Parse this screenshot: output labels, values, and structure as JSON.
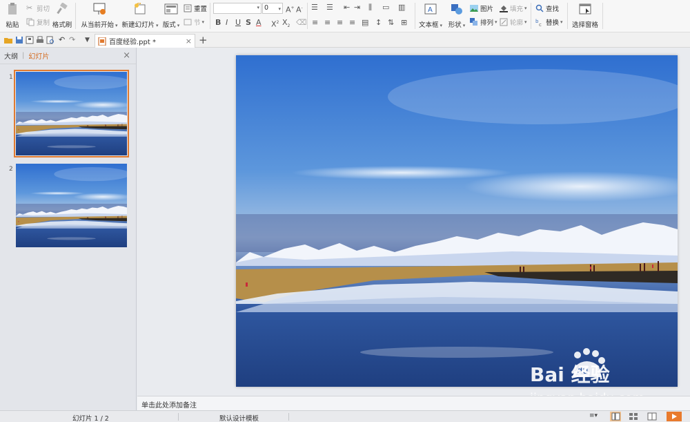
{
  "ribbon": {
    "clipboard": {
      "paste": "粘贴",
      "cut": "剪切",
      "copy": "复制",
      "format_painter": "格式刷"
    },
    "slides": {
      "from_current": "从当前开始",
      "new_slide": "新建幻灯片",
      "layout": "版式",
      "reset": "重置",
      "section": "节"
    },
    "font": {
      "font_name": "",
      "font_size": "0"
    },
    "drawing": {
      "textbox": "文本框",
      "shape": "形状",
      "picture": "图片",
      "arrange": "排列",
      "fill": "填充",
      "outline": "轮廓"
    },
    "editing": {
      "find": "查找",
      "replace": "替换",
      "select_pane": "选择窗格"
    }
  },
  "tab": {
    "title": "百度经验.ppt *"
  },
  "left_panel": {
    "tab_outline": "大纲",
    "tab_divider": "|",
    "tab_slides": "幻灯片",
    "slides": [
      {
        "num": "1"
      },
      {
        "num": "2"
      }
    ]
  },
  "notes": {
    "placeholder": "单击此处添加备注"
  },
  "status": {
    "slide_indicator": "幻灯片 1 / 2",
    "template": "默认设计模板"
  },
  "watermark": {
    "brand": "Bai  经验",
    "url": "jingyan.baidu.com"
  },
  "colors": {
    "accent": "#e07a30",
    "play": "#e97a2c",
    "sky_top": "#2f6fd0",
    "lake": "#24468a"
  }
}
